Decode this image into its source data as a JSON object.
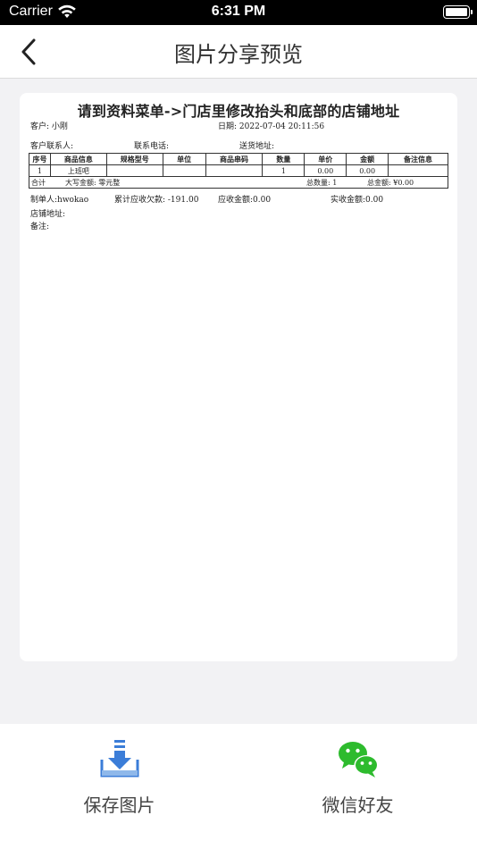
{
  "status_bar": {
    "carrier": "Carrier",
    "time": "6:31 PM"
  },
  "nav": {
    "title": "图片分享预览"
  },
  "document": {
    "title": "请到资料菜单->门店里修改抬头和底部的店铺地址",
    "customer": "客户: 小刚",
    "date": "日期: 2022-07-04 20:11:56",
    "contact": "客户联系人:",
    "phone": "联系电话:",
    "delivery_address": "送货地址:",
    "table": {
      "headers": [
        "序号",
        "商品信息",
        "规格型号",
        "单位",
        "商品串码",
        "数量",
        "单价",
        "金额",
        "备注信息"
      ],
      "rows": [
        [
          "1",
          "上班吧",
          "",
          "",
          "",
          "1",
          "0.00",
          "0.00",
          ""
        ]
      ],
      "total": {
        "label": "合计",
        "amount_in_words": "大写金额: 零元整",
        "total_qty": "总数量: 1",
        "total_amount": "总金额: ¥0.00"
      }
    },
    "creator": "制单人:hwokao",
    "arrears": "累计应收欠款: -191.00",
    "receivable": "应收金额:0.00",
    "received": "实收金额:0.00",
    "shop_address": "店铺地址:",
    "remark": "备注:"
  },
  "actions": {
    "save_label": "保存图片",
    "wechat_label": "微信好友"
  },
  "colors": {
    "wechat_green": "#2dbb2d",
    "save_blue": "#3b7dd8"
  }
}
